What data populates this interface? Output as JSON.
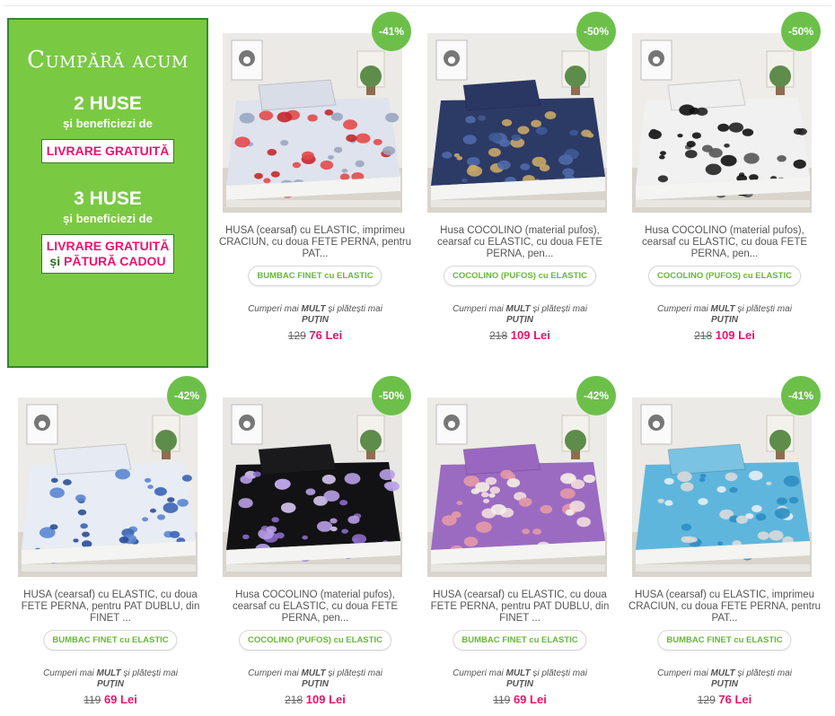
{
  "promo": {
    "heading": "Cumpără acum",
    "offer1_big": "2 HUSE",
    "offer1_sub": "și beneficiezi de",
    "offer1_pill": "LIVRARE GRATUITĂ",
    "offer2_big": "3 HUSE",
    "offer2_sub": "și beneficiezi de",
    "offer2_pill_line1": "LIVRARE GRATUITĂ",
    "offer2_pill_join": "și ",
    "offer2_pill_line2": "PĂTURĂ CADOU"
  },
  "compare_text": {
    "a": "Cumperi mai ",
    "b": "MULT",
    "c": " și plătești mai ",
    "d": "PUȚIN"
  },
  "currency": "Lei",
  "colors": {
    "accent_green": "#6cc04a",
    "promo_green": "#7ac943",
    "price_pink": "#e8146c"
  },
  "products": [
    {
      "discount": "-41%",
      "title": "HUSA (cearsaf) cu ELASTIC, imprimeu CRACIUN, cu doua FETE PERNA, pentru PAT...",
      "tag": "BUMBAC FINET cu ELASTIC",
      "old_price": "129",
      "new_price": "76 Lei",
      "pattern": "christmas"
    },
    {
      "discount": "-50%",
      "title": "Husa COCOLINO (material pufos), cearsaf cu ELASTIC, cu doua FETE PERNA, pen...",
      "tag": "COCOLINO (PUFOS) cu ELASTIC",
      "old_price": "218",
      "new_price": "109 Lei",
      "pattern": "navy-hex"
    },
    {
      "discount": "-50%",
      "title": "Husa COCOLINO (material pufos), cearsaf cu ELASTIC, cu doua FETE PERNA, pen...",
      "tag": "COCOLINO (PUFOS) cu ELASTIC",
      "old_price": "218",
      "new_price": "109 Lei",
      "pattern": "leopard"
    },
    {
      "discount": "-42%",
      "title": "HUSA (cearsaf) cu ELASTIC, cu doua FETE PERNA, pentru PAT DUBLU, din FINET ...",
      "tag": "BUMBAC FINET cu ELASTIC",
      "old_price": "119",
      "new_price": "69 Lei",
      "pattern": "blue-leaves"
    },
    {
      "discount": "-50%",
      "title": "Husa COCOLINO (material pufos), cearsaf cu ELASTIC, cu doua FETE PERNA, pen...",
      "tag": "COCOLINO (PUFOS) cu ELASTIC",
      "old_price": "218",
      "new_price": "109 Lei",
      "pattern": "butterflies"
    },
    {
      "discount": "-42%",
      "title": "HUSA (cearsaf) cu ELASTIC, cu doua FETE PERNA, pentru PAT DUBLU, din FINET ...",
      "tag": "BUMBAC FINET cu ELASTIC",
      "old_price": "119",
      "new_price": "69 Lei",
      "pattern": "purple-puppies"
    },
    {
      "discount": "-41%",
      "title": "HUSA (cearsaf) cu ELASTIC, imprimeu CRACIUN, cu doua FETE PERNA, pentru PAT...",
      "tag": "BUMBAC FINET cu ELASTIC",
      "old_price": "129",
      "new_price": "76 Lei",
      "pattern": "blue-christmas"
    }
  ]
}
